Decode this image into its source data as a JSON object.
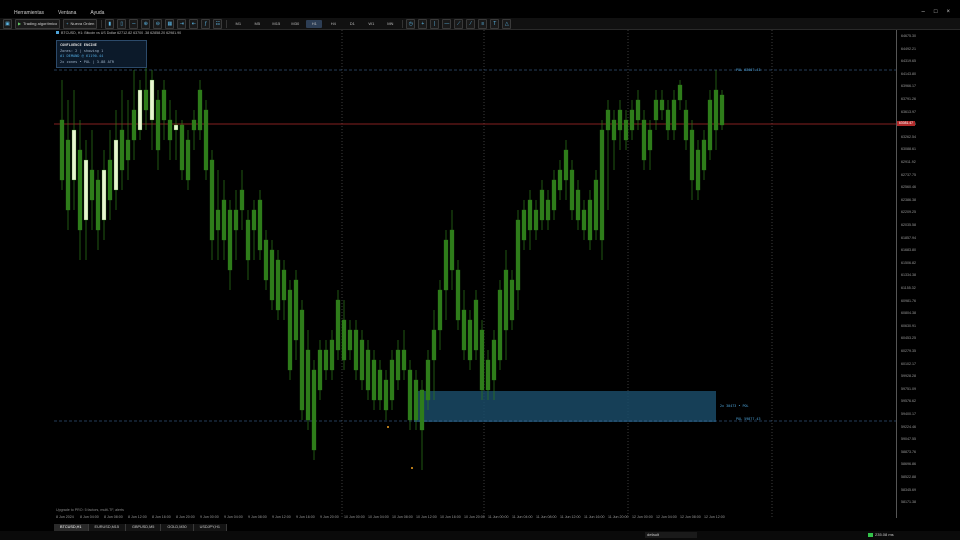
{
  "menubar": {
    "items": [
      "Herramientas",
      "Ventana",
      "Ayuda"
    ]
  },
  "toolbar": {
    "algo_trading": "Trading algorítmico",
    "new_order": "Nueva Orden",
    "timeframes": [
      "M1",
      "M5",
      "M15",
      "M30",
      "H1",
      "H4",
      "D1",
      "W1",
      "MN"
    ],
    "active_timeframe": "H1"
  },
  "chart": {
    "title": "BTCUSD, H1: Bitcoin vs US Dollar  62712.82 63700 .38 62858.20 62981.90",
    "panel": {
      "line1": "CONFLUENCE ENGINE",
      "line2": "Zones: 2 | showing 1",
      "line3": "#1 DEMAND @ 61190.44",
      "line4": "2x zones • POL | 3.88 ATR"
    },
    "zone_label_right": "2x 30473 • POL",
    "upper_line_label": "POL 63607.43",
    "lower_line_label": "POL 59877.43",
    "upgrade_text": "Upgrade to PRO: 5 factors, multi-TF, alerts",
    "current_price": "63081.47",
    "y_labels": [
      "64675.30",
      "64492.21",
      "64319.65",
      "64143.80",
      "63966.17",
      "63791.26",
      "63613.97",
      "63439.95",
      "63262.54",
      "63088.61",
      "62911.92",
      "62737.75",
      "62560.46",
      "62386.38",
      "62209.25",
      "62035.58",
      "61857.94",
      "61683.80",
      "61506.82",
      "61334.38",
      "61155.32",
      "60981.76",
      "60804.38",
      "60630.91",
      "60453.25",
      "60279.35",
      "60102.17",
      "59928.28",
      "59751.09",
      "59576.62",
      "59400.17",
      "59224.46",
      "59047.55",
      "58873.76",
      "58696.86",
      "58522.88",
      "58345.69",
      "58171.38"
    ],
    "x_labels": [
      "8 Jun 2024",
      "8 Jun 04:00",
      "8 Jun 08:00",
      "8 Jun 12:00",
      "8 Jun 16:00",
      "8 Jun 20:00",
      "9 Jun 00:00",
      "9 Jun 04:00",
      "9 Jun 08:00",
      "9 Jun 12:00",
      "9 Jun 16:00",
      "9 Jun 20:00",
      "10 Jun 00:00",
      "10 Jun 04:00",
      "10 Jun 08:00",
      "10 Jun 12:00",
      "10 Jun 16:00",
      "10 Jun 20:00",
      "11 Jun 00:00",
      "11 Jun 04:00",
      "11 Jun 08:00",
      "11 Jun 12:00",
      "11 Jun 16:00",
      "11 Jun 20:00",
      "12 Jun 00:00",
      "12 Jun 04:00",
      "12 Jun 08:00",
      "12 Jun 12:00"
    ],
    "colors": {
      "bull": "#e8f5d0",
      "bear": "#2e7d1a",
      "zone": "#1a4a66",
      "line": "#4a78b0",
      "price_line": "#b02a2a"
    }
  },
  "tabs": {
    "items": [
      "BTCUSD,H1",
      "EURUSD,M15",
      "GBPUSD,M5",
      "GOLD,M30",
      "USDJPY,H1"
    ],
    "active": 0
  },
  "status": {
    "profile": "default",
    "ping": "235.08 ms"
  }
}
